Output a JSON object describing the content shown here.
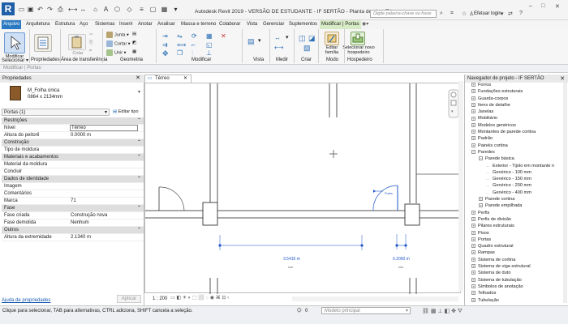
{
  "titlebar": {
    "logo": "R",
    "title": "Autodesk Revit 2019 - VERSÃO DE ESTUDANTE - IF SERTÃO - Planta de piso: Térreo",
    "search_placeholder": "Digite palavra-chave ou frase",
    "login": "Efetuar login"
  },
  "ribbon_tabs": [
    "Arquivo",
    "Arquitetura",
    "Estrutura",
    "Aço",
    "Sistemas",
    "Inserir",
    "Anotar",
    "Analisar",
    "Massa e terreno",
    "Colaborar",
    "Vista",
    "Gerenciar",
    "Suplementos",
    "Modificar | Portas"
  ],
  "ribbon": {
    "modify_label": "Modificar",
    "groups": [
      "Selecionar ▾",
      "Propriedades",
      "Área de transferência",
      "Geometria",
      "Modificar",
      "Vista",
      "Medir",
      "Criar",
      "Modo",
      "Hospedeiro"
    ],
    "geometry_items": [
      "Junta",
      "Cortar",
      "Unir"
    ],
    "paste_label": "Colar",
    "edit_family": "Editar família",
    "select_new_host": "Selecionar novo hospedeiro"
  },
  "optbar": {
    "text": "Modificar | Portas"
  },
  "properties": {
    "title": "Propriedades",
    "type_name": "M_Folha única",
    "type_size": "0864 x 2134mm",
    "instance_selector": "Portas (1)",
    "edit_type": "Editar tipo",
    "rows": [
      {
        "kind": "group",
        "name": "Restrições"
      },
      {
        "kind": "prop",
        "name": "Nível",
        "value": "Térreo"
      },
      {
        "kind": "prop",
        "name": "Altura do peitoril",
        "value": "0.0000 m"
      },
      {
        "kind": "group",
        "name": "Construção"
      },
      {
        "kind": "prop",
        "name": "Tipo de moldura",
        "value": ""
      },
      {
        "kind": "group",
        "name": "Materiais e acabamentos"
      },
      {
        "kind": "prop",
        "name": "Material da moldura",
        "value": ""
      },
      {
        "kind": "prop",
        "name": "Concluir",
        "value": ""
      },
      {
        "kind": "group",
        "name": "Dados de identidade"
      },
      {
        "kind": "prop",
        "name": "Imagem",
        "value": ""
      },
      {
        "kind": "prop",
        "name": "Comentários",
        "value": ""
      },
      {
        "kind": "prop",
        "name": "Marca",
        "value": "71"
      },
      {
        "kind": "group",
        "name": "Fase"
      },
      {
        "kind": "prop",
        "name": "Fase criada",
        "value": "Construção nova"
      },
      {
        "kind": "prop",
        "name": "Fase demolida",
        "value": "Nenhum"
      },
      {
        "kind": "group",
        "name": "Outros"
      },
      {
        "kind": "prop",
        "name": "Altura da extremidade",
        "value": "2.1340 m"
      }
    ],
    "help": "Ajuda de propriedades",
    "apply": "Aplicar"
  },
  "view": {
    "tab": "Térreo",
    "scale": "1 : 200",
    "dim1": "3.5416 m",
    "dim2": "0.2000 m",
    "door_tag": "Porta"
  },
  "browser": {
    "title": "Navegador de projeto - IF SERTÃO",
    "items": [
      {
        "label": "Forros",
        "level": 1,
        "sign": "+"
      },
      {
        "label": "Fundações estruturais",
        "level": 1,
        "sign": "+"
      },
      {
        "label": "Guarda-corpos",
        "level": 1,
        "sign": "+"
      },
      {
        "label": "Itens de detalhe",
        "level": 1,
        "sign": "+"
      },
      {
        "label": "Janelas",
        "level": 1,
        "sign": "+"
      },
      {
        "label": "Mobiliário",
        "level": 1,
        "sign": "+"
      },
      {
        "label": "Modelos genéricos",
        "level": 1,
        "sign": "+"
      },
      {
        "label": "Montantes de parede cortina",
        "level": 1,
        "sign": "+"
      },
      {
        "label": "Padrão",
        "level": 1,
        "sign": "+"
      },
      {
        "label": "Painéis cortina",
        "level": 1,
        "sign": "+"
      },
      {
        "label": "Paredes",
        "level": 1,
        "sign": "−"
      },
      {
        "label": "Parede básica",
        "level": 2,
        "sign": "−"
      },
      {
        "label": "Exterior - Tijolo em montante n",
        "level": 3,
        "sign": ""
      },
      {
        "label": "Genérico - 100 mm",
        "level": 3,
        "sign": ""
      },
      {
        "label": "Genérico - 150 mm",
        "level": 3,
        "sign": ""
      },
      {
        "label": "Genérico - 200 mm",
        "level": 3,
        "sign": ""
      },
      {
        "label": "Genérico - 400 mm",
        "level": 3,
        "sign": ""
      },
      {
        "label": "Parede cortina",
        "level": 2,
        "sign": "+"
      },
      {
        "label": "Parede empilhada",
        "level": 2,
        "sign": "+"
      },
      {
        "label": "Perfis",
        "level": 1,
        "sign": "+"
      },
      {
        "label": "Perfis de divisão",
        "level": 1,
        "sign": "+"
      },
      {
        "label": "Pilares estruturais",
        "level": 1,
        "sign": "+"
      },
      {
        "label": "Pisos",
        "level": 1,
        "sign": "+"
      },
      {
        "label": "Portas",
        "level": 1,
        "sign": "+"
      },
      {
        "label": "Quadro estrutural",
        "level": 1,
        "sign": "+"
      },
      {
        "label": "Rampas",
        "level": 1,
        "sign": "+"
      },
      {
        "label": "Sistema de cortina",
        "level": 1,
        "sign": "+"
      },
      {
        "label": "Sistema de viga estrutural",
        "level": 1,
        "sign": "+"
      },
      {
        "label": "Sistema de duto",
        "level": 1,
        "sign": "+"
      },
      {
        "label": "Sistema de tubulação",
        "level": 1,
        "sign": "+"
      },
      {
        "label": "Símbolos de anotação",
        "level": 1,
        "sign": "+"
      },
      {
        "label": "Telhados",
        "level": 1,
        "sign": "+"
      },
      {
        "label": "Tubulação",
        "level": 1,
        "sign": "+"
      }
    ]
  },
  "status": {
    "text": "Clique para selecionar, TAB para alternativas, CTRL adiciona, SHIFT cancela a seleção.",
    "model": "Modelo principal",
    "count": "0"
  },
  "colors": {
    "accent": "#2b79c2",
    "context_tab": "#d7ecc6",
    "drawing_blue": "#1f56c9"
  }
}
